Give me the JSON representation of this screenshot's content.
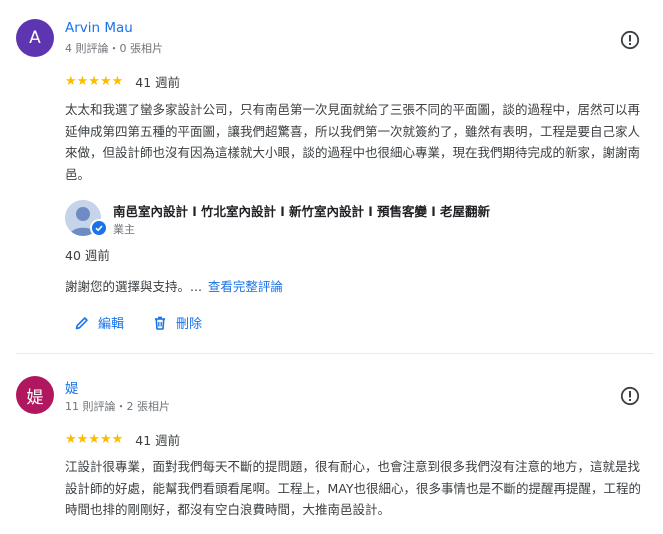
{
  "reviews": [
    {
      "avatar_letter": "A",
      "avatar_color": "#5e35b1",
      "name": "Arvin Mau",
      "meta": "4 則評論・0 張相片",
      "stars": "★★★★★",
      "rating": 5,
      "time": "41 週前",
      "text": "太太和我選了蠻多家設計公司，只有南邑第一次見面就給了三張不同的平面圖，談的過程中，居然可以再延伸成第四第五種的平面圖，讓我們超驚喜，所以我們第一次就簽約了，雖然有表明，工程是要自己家人來做，但設計師也沒有因為這樣就大小眼，談的過程中也很細心專業，現在我們期待完成的新家，謝謝南邑。",
      "owner": {
        "name": "南邑室內設計 l 竹北室內設計 l 新竹室內設計 l 預售客變 l 老屋翻新",
        "role": "業主",
        "time": "40 週前",
        "reply": "謝謝您的選擇與支持。...",
        "more": "查看完整評論"
      },
      "actions": {
        "edit": "編輯",
        "delete": "刪除"
      }
    },
    {
      "avatar_letter": "媞",
      "avatar_color": "#b0175f",
      "name": "媞",
      "meta": "11 則評論・2 張相片",
      "stars": "★★★★★",
      "rating": 5,
      "time": "41 週前",
      "text": "江設計很專業，面對我們每天不斷的提問題，很有耐心，也會注意到很多我們沒有注意的地方，這就是找設計師的好處，能幫我們看頭看尾啊。工程上，MAY也很細心，很多事情也是不斷的提醒再提醒，工程的時間也排的剛剛好，都沒有空白浪費時間，大推南邑設計。"
    }
  ]
}
